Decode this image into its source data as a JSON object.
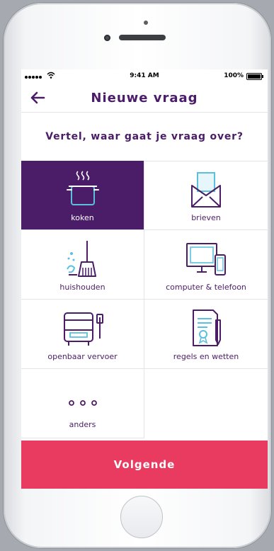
{
  "status": {
    "time": "9:41 AM",
    "battery": "100%"
  },
  "nav": {
    "title": "Nieuwe vraag",
    "back_icon": "arrow-left-icon"
  },
  "question": "Vertel, waar gaat je vraag over?",
  "categories": [
    {
      "label": "koken",
      "icon": "cooking-pot-icon",
      "selected": true
    },
    {
      "label": "brieven",
      "icon": "envelope-letter-icon",
      "selected": false
    },
    {
      "label": "huishouden",
      "icon": "broom-icon",
      "selected": false
    },
    {
      "label": "computer & telefoon",
      "icon": "computer-phone-icon",
      "selected": false
    },
    {
      "label": "openbaar vervoer",
      "icon": "bus-icon",
      "selected": false
    },
    {
      "label": "regels en wetten",
      "icon": "document-certificate-icon",
      "selected": false
    },
    {
      "label": "anders",
      "icon": "more-dots-icon",
      "selected": false
    }
  ],
  "next_button": "Volgende",
  "colors": {
    "primary": "#4b1c68",
    "accent": "#e93b5f",
    "icon_blue": "#5bc0de"
  }
}
